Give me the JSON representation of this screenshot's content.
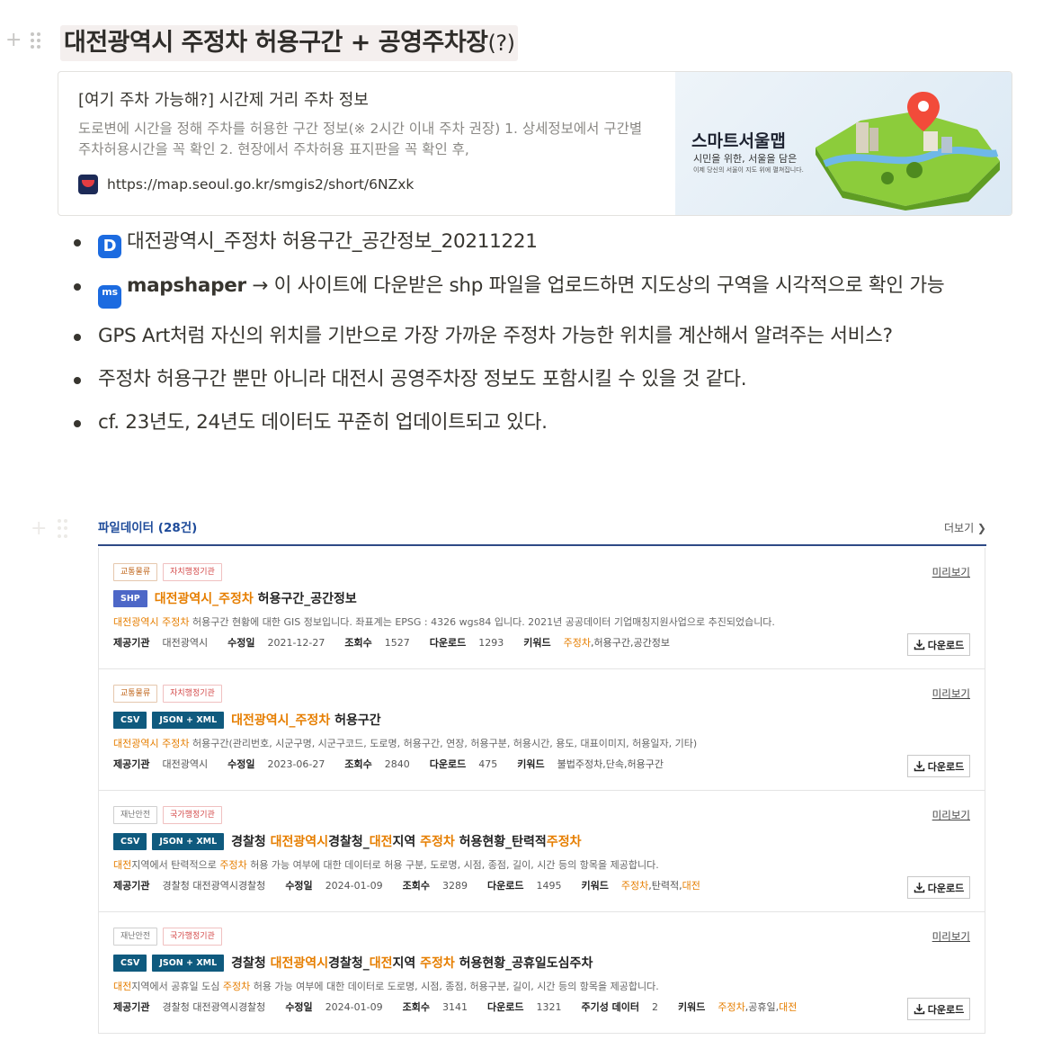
{
  "heading": {
    "text": "대전광역시 주정차 허용구간 + 공영주차장",
    "suffix": "(?)"
  },
  "bookmark": {
    "title": "[여기 주차 가능해?] 시간제 거리 주차 정보",
    "description": "도로변에 시간을 정해 주차를 허용한 구간 정보(※ 2시간 이내 주차 권장) 1. 상세정보에서 구간별 주차허용시간을 꼭 확인 2. 현장에서 주차허용 표지판을 꼭 확인 후,",
    "url": "https://map.seoul.go.kr/smgis2/short/6NZxk",
    "image_title": "스마트서울맵",
    "image_subtitle": "시민을 위한, 서울을 담은",
    "image_caption": "이제 당신의 서울이 지도 위에 펼쳐집니다."
  },
  "bullets": [
    {
      "icon": "D",
      "text": "대전광역시_주정차 허용구간_공간정보_20211221"
    },
    {
      "icon": "ms",
      "link": "mapshaper",
      "text": " → 이 사이트에 다운받은 shp 파일을 업로드하면 지도상의 구역을 시각적으로 확인 가능"
    },
    {
      "text": "GPS Art처럼 자신의 위치를 기반으로 가장 가까운 주정차 가능한 위치를 계산해서 알려주는 서비스?"
    },
    {
      "text": "주정차 허용구간 뿐만 아니라 대전시 공영주차장 정보도 포함시킬 수 있을 것 같다."
    },
    {
      "text": "cf. 23년도, 24년도 데이터도 꾸준히 업데이트되고 있다."
    }
  ],
  "panel": {
    "title": "파일데이터 (28건)",
    "more": "더보기 ❯",
    "preview": "미리보기",
    "download": "다운로드"
  },
  "items": [
    {
      "tags": [
        "교통물류",
        "자치행정기관"
      ],
      "formats": [
        "SHP"
      ],
      "title_parts": [
        "대전광역시_주정차",
        " 허용구간_공간정보"
      ],
      "desc_hl": "대전광역시 주정차",
      "desc": " 허용구간 현황에 대한 GIS 정보입니다. 좌표계는 EPSG : 4326 wgs84 입니다. 2021년 공공데이터 기업매칭지원사업으로 추진되었습니다.",
      "provider_label": "제공기관",
      "provider": "대전광역시",
      "modified_label": "수정일",
      "modified": "2021-12-27",
      "views_label": "조회수",
      "views": "1527",
      "downloads_label": "다운로드",
      "downloads": "1293",
      "keywords_label": "키워드",
      "keywords_hl": "주정차",
      "keywords": ",허용구간,공간정보"
    },
    {
      "tags": [
        "교통물류",
        "자치행정기관"
      ],
      "formats": [
        "CSV",
        "JSON + XML"
      ],
      "title_parts": [
        "대전광역시_주정차",
        " 허용구간"
      ],
      "desc_hl": "대전광역시 주정차",
      "desc": " 허용구간(관리번호, 시군구명, 시군구코드, 도로명, 허용구간, 연장, 허용구분, 허용시간, 용도, 대표이미지, 허용일자, 기타)",
      "provider_label": "제공기관",
      "provider": "대전광역시",
      "modified_label": "수정일",
      "modified": "2023-06-27",
      "views_label": "조회수",
      "views": "2840",
      "downloads_label": "다운로드",
      "downloads": "475",
      "keywords_label": "키워드",
      "keywords_plain": "불법주정차,단속,허용구간"
    },
    {
      "tags": [
        "재난안전",
        "국가행정기관"
      ],
      "formats": [
        "CSV",
        "JSON + XML"
      ],
      "title_pre": "경찰청 ",
      "title_html_parts": [
        [
          "대전광역시",
          true
        ],
        [
          "경찰청_",
          false
        ],
        [
          "대전",
          true
        ],
        [
          "지역 ",
          false
        ],
        [
          "주정차",
          true
        ],
        [
          " 허용현황_탄력적",
          false
        ],
        [
          "주정차",
          true
        ]
      ],
      "desc_hl": "대전",
      "desc_mid": "지역에서 탄력적으로 ",
      "desc_hl2": "주정차",
      "desc": " 허용 가능 여부에 대한 데이터로 허용 구분, 도로명, 시점, 종점, 길이, 시간 등의 항목을 제공합니다.",
      "provider_label": "제공기관",
      "provider": "경찰청 대전광역시경찰청",
      "modified_label": "수정일",
      "modified": "2024-01-09",
      "views_label": "조회수",
      "views": "3289",
      "downloads_label": "다운로드",
      "downloads": "1495",
      "keywords_label": "키워드",
      "keywords_hl": "주정차",
      "keywords": ",탄력적,",
      "keywords_hl2": "대전"
    },
    {
      "tags": [
        "재난안전",
        "국가행정기관"
      ],
      "formats": [
        "CSV",
        "JSON + XML"
      ],
      "title_pre": "경찰청 ",
      "title_html_parts": [
        [
          "대전광역시",
          true
        ],
        [
          "경찰청_",
          false
        ],
        [
          "대전",
          true
        ],
        [
          "지역 ",
          false
        ],
        [
          "주정차",
          true
        ],
        [
          " 허용현황_공휴일도심주차",
          false
        ]
      ],
      "desc_hl": "대전",
      "desc_mid": "지역에서 공휴일 도심 ",
      "desc_hl2": "주정차",
      "desc": " 허용 가능 여부에 대한 데이터로 도로명, 시점, 종점, 허용구분, 길이, 시간 등의 항목을 제공합니다.",
      "provider_label": "제공기관",
      "provider": "경찰청 대전광역시경찰청",
      "modified_label": "수정일",
      "modified": "2024-01-09",
      "views_label": "조회수",
      "views": "3141",
      "downloads_label": "다운로드",
      "downloads": "1321",
      "periodic_label": "주기성 데이터",
      "periodic": "2",
      "keywords_label": "키워드",
      "keywords_hl": "주정차",
      "keywords": ",공휴일,",
      "keywords_hl2": "대전"
    }
  ],
  "colors": {
    "accent": "#1e4b9a",
    "highlight": "#e67e00",
    "shp": "#4d67c7",
    "csv": "#0f5a7e"
  }
}
